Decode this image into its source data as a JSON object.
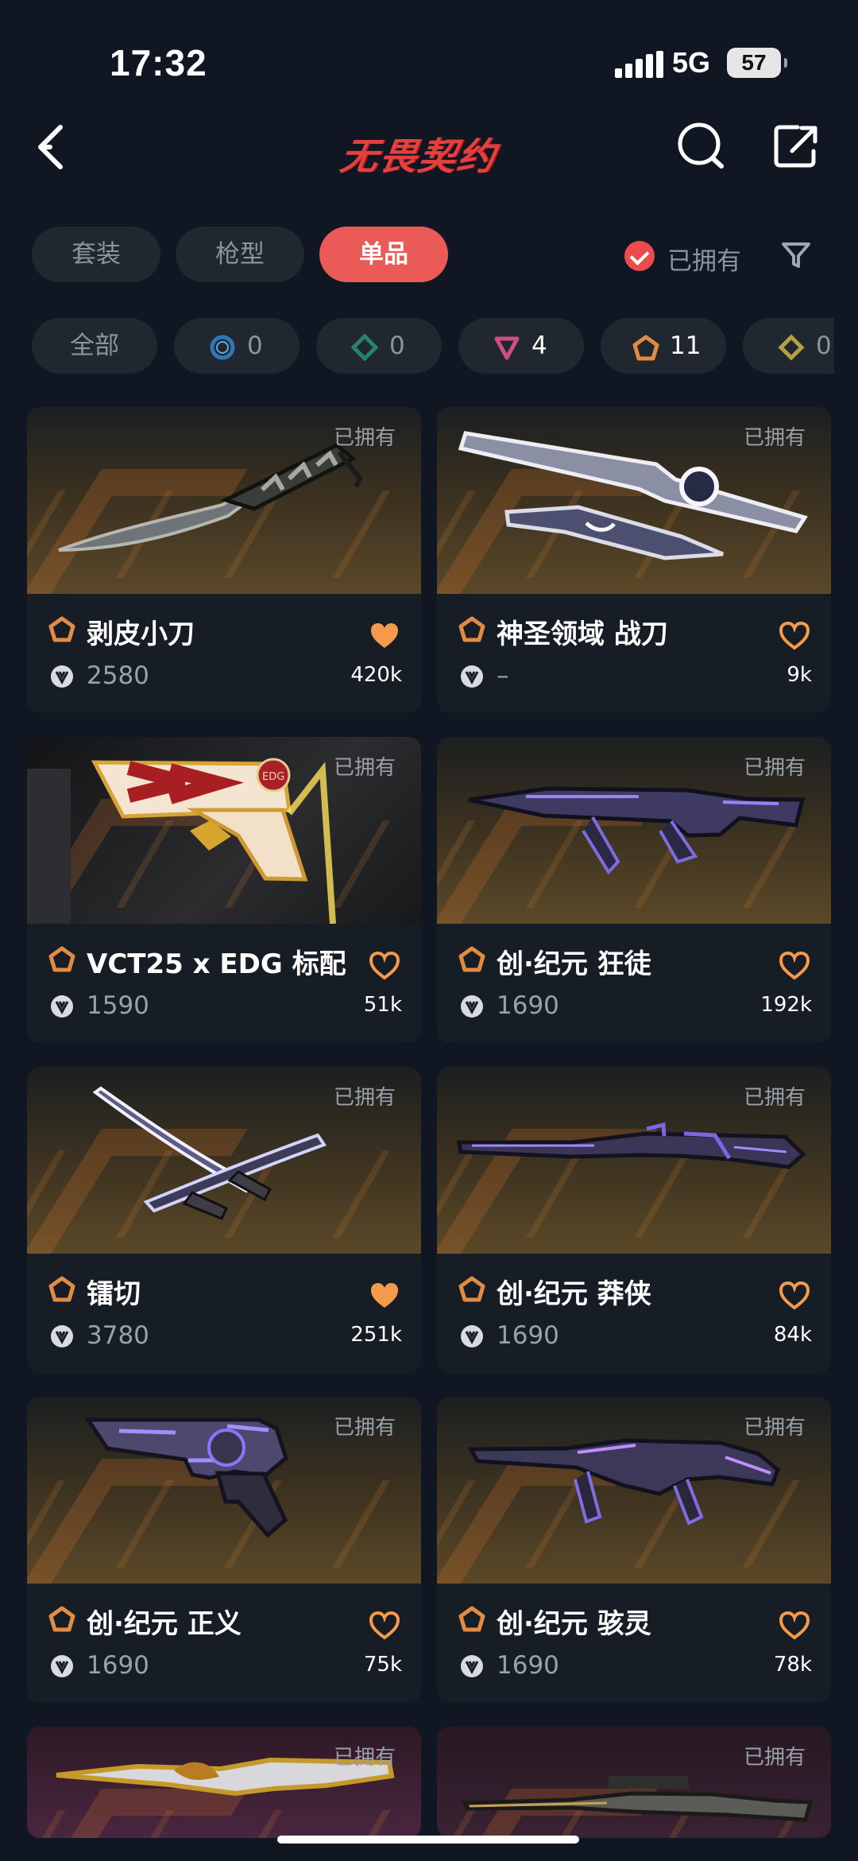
{
  "status_bar": {
    "time": "17:32",
    "network": "5G",
    "battery": "57"
  },
  "header": {
    "title": "无畏契约",
    "back_icon": "back-arrow-icon",
    "search_icon": "search-icon",
    "share_icon": "share-icon"
  },
  "tabs": [
    {
      "label": "套装",
      "active": false
    },
    {
      "label": "枪型",
      "active": false
    },
    {
      "label": "单品",
      "active": true
    }
  ],
  "owned_filter": {
    "label": "已拥有",
    "checked": true
  },
  "tier_filters": [
    {
      "label": "全部"
    },
    {
      "icon": "circle-tier-icon",
      "count": "0",
      "color": "#2e78b7"
    },
    {
      "icon": "diamond-tier-icon",
      "count": "0",
      "color": "#27816d"
    },
    {
      "icon": "triangle-tier-icon",
      "count": "4",
      "color": "#d44c84"
    },
    {
      "icon": "pentagon-tier-icon",
      "count": "11",
      "color": "#e28c43"
    },
    {
      "icon": "diamond-tier-icon",
      "count": "0",
      "color": "#b69f42"
    }
  ],
  "items": [
    {
      "owned": "已拥有",
      "name": "剥皮小刀",
      "price": "2580",
      "likes": "420k",
      "liked": true,
      "weapon": "knife"
    },
    {
      "owned": "已拥有",
      "name": "神圣领域 战刀",
      "price": "–",
      "likes": "9k",
      "liked": false,
      "weapon": "sword"
    },
    {
      "owned": "已拥有",
      "name": "VCT25 x EDG 标配",
      "price": "1590",
      "likes": "51k",
      "liked": false,
      "weapon": "pistol"
    },
    {
      "owned": "已拥有",
      "name": "创·纪元 狂徒",
      "price": "1690",
      "likes": "192k",
      "liked": false,
      "weapon": "rifle"
    },
    {
      "owned": "已拥有",
      "name": "镭切",
      "price": "3780",
      "likes": "251k",
      "liked": true,
      "weapon": "katana"
    },
    {
      "owned": "已拥有",
      "name": "创·纪元 莽侠",
      "price": "1690",
      "likes": "84k",
      "liked": false,
      "weapon": "sniper"
    },
    {
      "owned": "已拥有",
      "name": "创·纪元 正义",
      "price": "1690",
      "likes": "75k",
      "liked": false,
      "weapon": "revolver"
    },
    {
      "owned": "已拥有",
      "name": "创·纪元 骇灵",
      "price": "1690",
      "likes": "78k",
      "liked": false,
      "weapon": "smg"
    },
    {
      "owned": "已拥有",
      "name": "",
      "price": "",
      "likes": "",
      "liked": false,
      "weapon": "gold-rifle"
    },
    {
      "owned": "已拥有",
      "name": "",
      "price": "",
      "likes": "",
      "liked": false,
      "weapon": "scope-rifle"
    }
  ]
}
